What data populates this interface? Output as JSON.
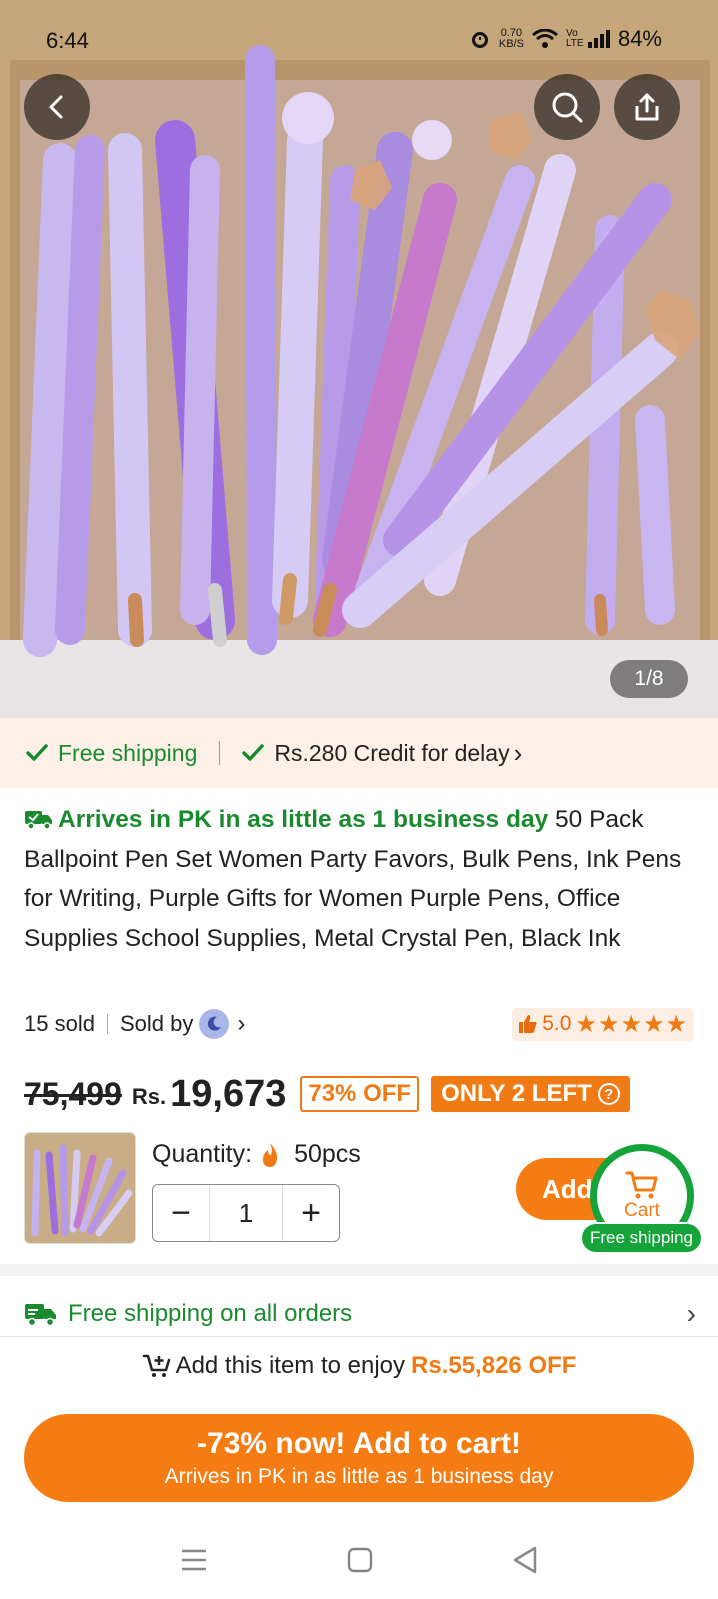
{
  "status_bar": {
    "time": "6:44",
    "net_speed_value": "0.70",
    "net_speed_unit": "KB/S",
    "volte_label": "Vo LTE",
    "battery": "84%"
  },
  "gallery": {
    "page_indicator": "1/8"
  },
  "shipping_strip": {
    "free_shipping": "Free shipping",
    "credit": "Rs.280 Credit for delay",
    "credit_chevron": "›"
  },
  "product": {
    "arrival": "Arrives in PK in as little as 1 business day",
    "title": "50 Pack Ballpoint Pen Set Women Party Favors, Bulk Pens, Ink Pens for Writing, Purple Gifts for Women Purple Pens, Office Supplies School Supplies, Metal Crystal Pen, Black Ink",
    "sold": "15 sold",
    "sold_by": "Sold by",
    "rating": "5.0",
    "stars": "★★★★★",
    "old_price": "75,499",
    "currency": "Rs.",
    "new_price": "19,673",
    "discount": "73% OFF",
    "stock": "ONLY 2 LEFT"
  },
  "quantity": {
    "label": "Quantity:",
    "variant": "50pcs",
    "minus": "−",
    "value": "1",
    "plus": "+"
  },
  "cart": {
    "add_label": "Add",
    "cart_label": "Cart",
    "free_shipping": "Free shipping"
  },
  "promo": {
    "free_all": "Free shipping on all orders",
    "enjoy": "Add this item to enjoy",
    "enjoy_amount": "Rs.55,826 OFF"
  },
  "cta": {
    "main": "-73% now! Add to cart!",
    "sub": "Arrives in PK in as little as 1 business day"
  },
  "colors": {
    "accent_orange": "#f57c13",
    "shipping_green": "#1a8a2e",
    "cart_green": "#16a43a",
    "strip_bg": "#fdf0e6"
  }
}
